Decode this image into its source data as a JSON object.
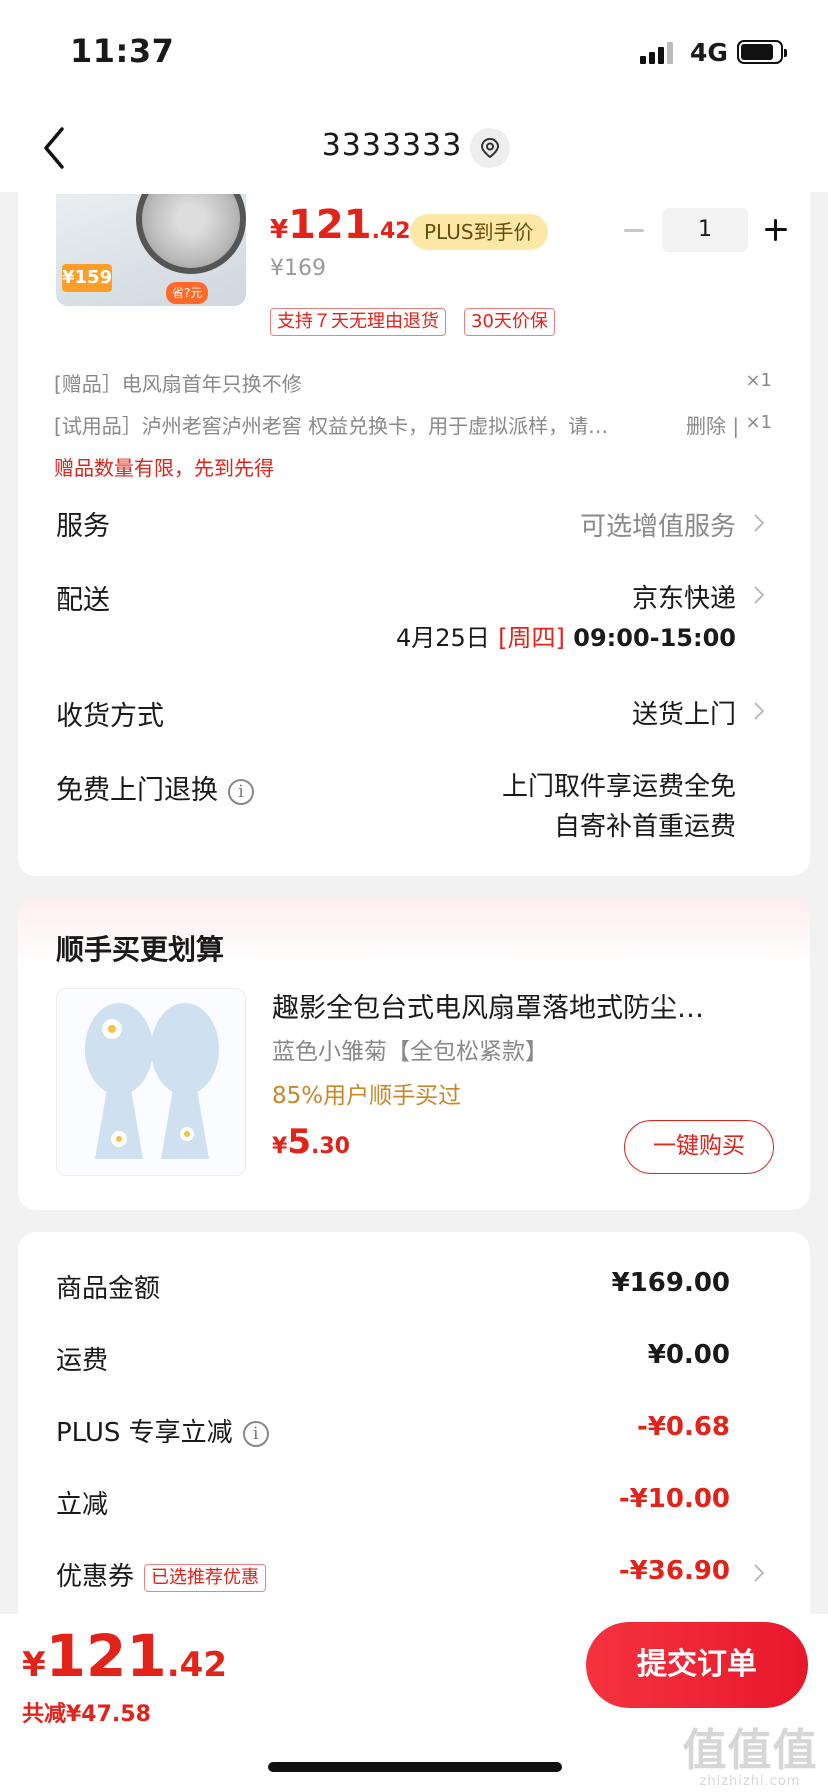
{
  "status": {
    "time": "11:37",
    "network": "4G"
  },
  "nav": {
    "title": "3333333"
  },
  "product": {
    "image_badge": "¥159",
    "image_tag": "省?元",
    "price_currency": "¥",
    "price_int": "121",
    "price_dec": ".42",
    "plus_label": "PLUS到手价",
    "original_price": "¥169",
    "tags": [
      "支持７天无理由退货",
      "30天价保"
    ],
    "quantity": "1"
  },
  "gifts": [
    {
      "text": "[赠品］电风扇首年只换不修",
      "qty": "×1"
    },
    {
      "text": "[试用品］泸州老窖泸州老窖  权益兑换卡，用于虚拟派样，请…",
      "action": "删除 |",
      "qty": "×1"
    }
  ],
  "gift_note": "赠品数量有限，先到先得",
  "service": {
    "label": "服务",
    "value": "可选增值服务"
  },
  "delivery": {
    "label": "配送",
    "carrier": "京东快递",
    "date": "4月25日",
    "weekday": "[周四]",
    "window": "09:00-15:00"
  },
  "receive": {
    "label": "收货方式",
    "value": "送货上门"
  },
  "free_return": {
    "label": "免费上门退换",
    "info_icon": "i",
    "line1": "上门取件享运费全免",
    "line2": "自寄补首重运费"
  },
  "addon": {
    "title": "顺手买更划算",
    "name": "趣影全包台式电风扇罩落地式防尘…",
    "spec": "蓝色小雏菊【全包松紧款】",
    "stat": "85%用户顺手买过",
    "price_currency": "¥",
    "price_int": "5",
    "price_dec": ".30",
    "buy_label": "一键购买"
  },
  "summary": [
    {
      "label": "商品金额",
      "value": "¥169.00",
      "red": false
    },
    {
      "label": "运费",
      "value": "¥0.00",
      "red": false
    },
    {
      "label": "PLUS 专享立减",
      "value": "-¥0.68",
      "red": true,
      "info": true
    },
    {
      "label": "立减",
      "value": "-¥10.00",
      "red": true
    },
    {
      "label": "优惠券",
      "value": "-¥36.90",
      "red": true,
      "tag": "已选推荐优惠",
      "chevron": true
    }
  ],
  "footer": {
    "total_currency": "¥",
    "total_int": "121",
    "total_dec": ".42",
    "saved": "共减¥47.58",
    "submit_label": "提交订单",
    "watermark_big": "值值值",
    "watermark_small": "zhizhizhi.com"
  },
  "colors": {
    "accent": "#e2231a",
    "plus_bg": "#fde8a8",
    "page_bg": "#f2f2f2"
  }
}
